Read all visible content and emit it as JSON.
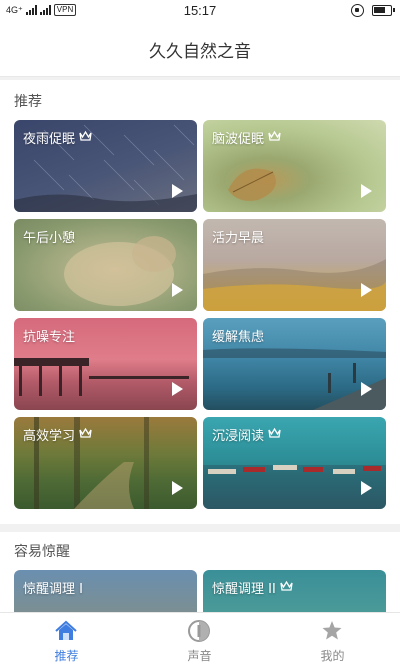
{
  "status_bar": {
    "network": "4G⁺",
    "vpn": "VPN",
    "time": "15:17"
  },
  "app": {
    "title": "久久自然之音"
  },
  "recommend": {
    "title": "推荐",
    "cards": [
      {
        "title": "夜雨促眠",
        "premium": true
      },
      {
        "title": "脑波促眠",
        "premium": true
      },
      {
        "title": "午后小憩",
        "premium": false
      },
      {
        "title": "活力早晨",
        "premium": false
      },
      {
        "title": "抗噪专注",
        "premium": false
      },
      {
        "title": "缓解焦虑",
        "premium": false
      },
      {
        "title": "高效学习",
        "premium": true
      },
      {
        "title": "沉浸阅读",
        "premium": true
      }
    ]
  },
  "easy_wake": {
    "title": "容易惊醒",
    "cards": [
      {
        "title": "惊醒调理 I",
        "premium": false
      },
      {
        "title": "惊醒调理 II",
        "premium": true
      }
    ]
  },
  "tabs": [
    {
      "label": "推荐",
      "icon": "home-icon",
      "active": true
    },
    {
      "label": "声音",
      "icon": "sound-icon",
      "active": false
    },
    {
      "label": "我的",
      "icon": "star-profile-icon",
      "active": false
    }
  ],
  "colors": {
    "accent": "#3f7de0",
    "tab_inactive": "#888888"
  }
}
